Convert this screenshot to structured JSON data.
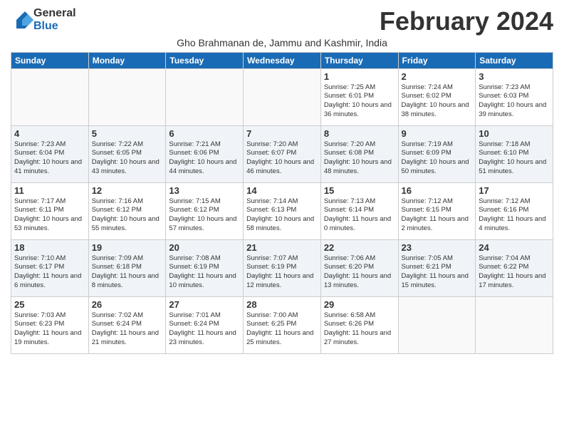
{
  "header": {
    "logo_general": "General",
    "logo_blue": "Blue",
    "month_title": "February 2024",
    "subtitle": "Gho Brahmanan de, Jammu and Kashmir, India"
  },
  "days_of_week": [
    "Sunday",
    "Monday",
    "Tuesday",
    "Wednesday",
    "Thursday",
    "Friday",
    "Saturday"
  ],
  "weeks": [
    [
      {
        "day": "",
        "info": ""
      },
      {
        "day": "",
        "info": ""
      },
      {
        "day": "",
        "info": ""
      },
      {
        "day": "",
        "info": ""
      },
      {
        "day": "1",
        "info": "Sunrise: 7:25 AM\nSunset: 6:01 PM\nDaylight: 10 hours\nand 36 minutes."
      },
      {
        "day": "2",
        "info": "Sunrise: 7:24 AM\nSunset: 6:02 PM\nDaylight: 10 hours\nand 38 minutes."
      },
      {
        "day": "3",
        "info": "Sunrise: 7:23 AM\nSunset: 6:03 PM\nDaylight: 10 hours\nand 39 minutes."
      }
    ],
    [
      {
        "day": "4",
        "info": "Sunrise: 7:23 AM\nSunset: 6:04 PM\nDaylight: 10 hours\nand 41 minutes."
      },
      {
        "day": "5",
        "info": "Sunrise: 7:22 AM\nSunset: 6:05 PM\nDaylight: 10 hours\nand 43 minutes."
      },
      {
        "day": "6",
        "info": "Sunrise: 7:21 AM\nSunset: 6:06 PM\nDaylight: 10 hours\nand 44 minutes."
      },
      {
        "day": "7",
        "info": "Sunrise: 7:20 AM\nSunset: 6:07 PM\nDaylight: 10 hours\nand 46 minutes."
      },
      {
        "day": "8",
        "info": "Sunrise: 7:20 AM\nSunset: 6:08 PM\nDaylight: 10 hours\nand 48 minutes."
      },
      {
        "day": "9",
        "info": "Sunrise: 7:19 AM\nSunset: 6:09 PM\nDaylight: 10 hours\nand 50 minutes."
      },
      {
        "day": "10",
        "info": "Sunrise: 7:18 AM\nSunset: 6:10 PM\nDaylight: 10 hours\nand 51 minutes."
      }
    ],
    [
      {
        "day": "11",
        "info": "Sunrise: 7:17 AM\nSunset: 6:11 PM\nDaylight: 10 hours\nand 53 minutes."
      },
      {
        "day": "12",
        "info": "Sunrise: 7:16 AM\nSunset: 6:12 PM\nDaylight: 10 hours\nand 55 minutes."
      },
      {
        "day": "13",
        "info": "Sunrise: 7:15 AM\nSunset: 6:12 PM\nDaylight: 10 hours\nand 57 minutes."
      },
      {
        "day": "14",
        "info": "Sunrise: 7:14 AM\nSunset: 6:13 PM\nDaylight: 10 hours\nand 58 minutes."
      },
      {
        "day": "15",
        "info": "Sunrise: 7:13 AM\nSunset: 6:14 PM\nDaylight: 11 hours\nand 0 minutes."
      },
      {
        "day": "16",
        "info": "Sunrise: 7:12 AM\nSunset: 6:15 PM\nDaylight: 11 hours\nand 2 minutes."
      },
      {
        "day": "17",
        "info": "Sunrise: 7:12 AM\nSunset: 6:16 PM\nDaylight: 11 hours\nand 4 minutes."
      }
    ],
    [
      {
        "day": "18",
        "info": "Sunrise: 7:10 AM\nSunset: 6:17 PM\nDaylight: 11 hours\nand 6 minutes."
      },
      {
        "day": "19",
        "info": "Sunrise: 7:09 AM\nSunset: 6:18 PM\nDaylight: 11 hours\nand 8 minutes."
      },
      {
        "day": "20",
        "info": "Sunrise: 7:08 AM\nSunset: 6:19 PM\nDaylight: 11 hours\nand 10 minutes."
      },
      {
        "day": "21",
        "info": "Sunrise: 7:07 AM\nSunset: 6:19 PM\nDaylight: 11 hours\nand 12 minutes."
      },
      {
        "day": "22",
        "info": "Sunrise: 7:06 AM\nSunset: 6:20 PM\nDaylight: 11 hours\nand 13 minutes."
      },
      {
        "day": "23",
        "info": "Sunrise: 7:05 AM\nSunset: 6:21 PM\nDaylight: 11 hours\nand 15 minutes."
      },
      {
        "day": "24",
        "info": "Sunrise: 7:04 AM\nSunset: 6:22 PM\nDaylight: 11 hours\nand 17 minutes."
      }
    ],
    [
      {
        "day": "25",
        "info": "Sunrise: 7:03 AM\nSunset: 6:23 PM\nDaylight: 11 hours\nand 19 minutes."
      },
      {
        "day": "26",
        "info": "Sunrise: 7:02 AM\nSunset: 6:24 PM\nDaylight: 11 hours\nand 21 minutes."
      },
      {
        "day": "27",
        "info": "Sunrise: 7:01 AM\nSunset: 6:24 PM\nDaylight: 11 hours\nand 23 minutes."
      },
      {
        "day": "28",
        "info": "Sunrise: 7:00 AM\nSunset: 6:25 PM\nDaylight: 11 hours\nand 25 minutes."
      },
      {
        "day": "29",
        "info": "Sunrise: 6:58 AM\nSunset: 6:26 PM\nDaylight: 11 hours\nand 27 minutes."
      },
      {
        "day": "",
        "info": ""
      },
      {
        "day": "",
        "info": ""
      }
    ]
  ]
}
